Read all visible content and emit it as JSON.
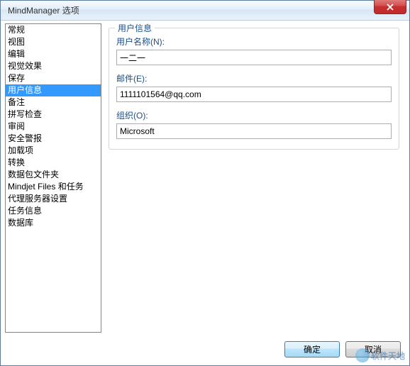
{
  "window": {
    "title": "MindManager 选项"
  },
  "sidebar": {
    "items": [
      {
        "label": "常规"
      },
      {
        "label": "视图"
      },
      {
        "label": "编辑"
      },
      {
        "label": "视觉效果"
      },
      {
        "label": "保存"
      },
      {
        "label": "用户信息",
        "selected": true
      },
      {
        "label": "备注"
      },
      {
        "label": "拼写检查"
      },
      {
        "label": "审阅"
      },
      {
        "label": "安全警报"
      },
      {
        "label": "加载项"
      },
      {
        "label": "转换"
      },
      {
        "label": "数据包文件夹"
      },
      {
        "label": "Mindjet Files 和任务"
      },
      {
        "label": "代理服务器设置"
      },
      {
        "label": "任务信息"
      },
      {
        "label": "数据库"
      }
    ]
  },
  "main": {
    "section_title": "用户信息",
    "username_label": "用户名称(N):",
    "username_value": "一二一",
    "email_label": "邮件(E):",
    "email_value": "1111101564@qq.com",
    "org_label": "组织(O):",
    "org_value": "Microsoft"
  },
  "footer": {
    "ok": "确定",
    "cancel": "取消"
  },
  "watermark": {
    "text": "软件天地"
  }
}
